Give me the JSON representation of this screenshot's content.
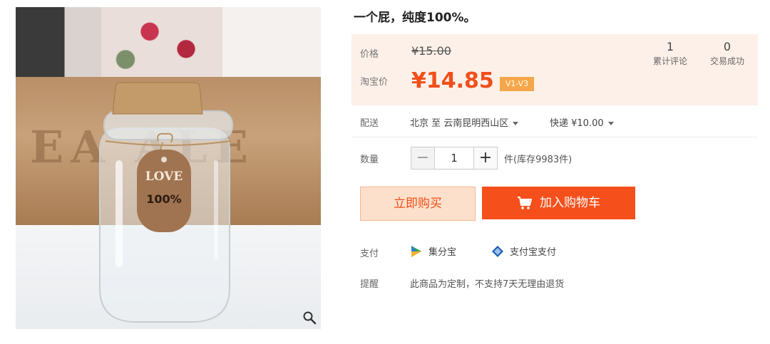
{
  "product": {
    "title": "一个屁，纯度100%。",
    "image_text": {
      "box_letters": "EA  ALE",
      "tag_line1": "LOVE",
      "tag_line2": "100%"
    }
  },
  "price": {
    "original_label": "价格",
    "original_value": "¥15.00",
    "taobao_label": "淘宝价",
    "current_value": "¥14.85",
    "vip_badge": "V1-V3"
  },
  "stats": [
    {
      "num": "1",
      "caption": "累计评论"
    },
    {
      "num": "0",
      "caption": "交易成功"
    }
  ],
  "shipping": {
    "label": "配送",
    "route": "北京 至 云南昆明西山区",
    "method": "快递 ¥10.00"
  },
  "quantity": {
    "label": "数量",
    "minus": "−",
    "value": "1",
    "plus": "+",
    "stock": "件(库存9983件)"
  },
  "actions": {
    "buy_now": "立即购买",
    "add_to_cart": "加入购物车"
  },
  "payment": {
    "label": "支付",
    "options": [
      "集分宝",
      "支付宝支付"
    ]
  },
  "notice": {
    "label": "提醒",
    "text": "此商品为定制，不支持7天无理由退货"
  },
  "colors": {
    "accent": "#f24e1a",
    "price_panel_bg": "#fdf0e8",
    "cart_button": "#f5501c"
  }
}
